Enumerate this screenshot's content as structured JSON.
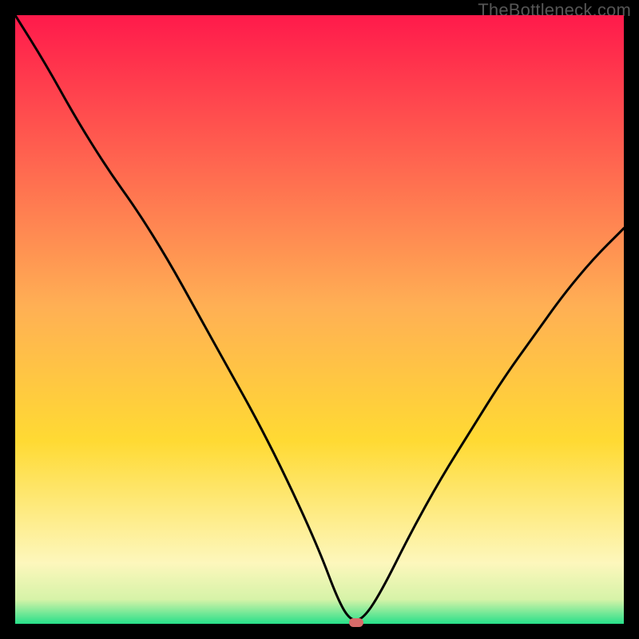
{
  "watermark": "TheBottleneck.com",
  "colors": {
    "top": "#ff1a4b",
    "mid": "#ffda33",
    "cream": "#fdf7bc",
    "bottom": "#27e08a",
    "curve": "#000000",
    "marker": "#d86b6a",
    "frame": "#000000"
  },
  "chart_data": {
    "type": "line",
    "title": "",
    "xlabel": "",
    "ylabel": "",
    "xlim": [
      0,
      100
    ],
    "ylim": [
      0,
      100
    ],
    "min_x": 56,
    "x": [
      0,
      5,
      10,
      15,
      20,
      25,
      30,
      35,
      40,
      45,
      50,
      53,
      55,
      57,
      60,
      65,
      70,
      75,
      80,
      85,
      90,
      95,
      100
    ],
    "values": [
      100,
      92,
      83,
      75,
      68,
      60,
      51,
      42,
      33,
      23,
      12,
      4,
      0.6,
      0.6,
      5,
      15,
      24,
      32,
      40,
      47,
      54,
      60,
      65
    ]
  }
}
